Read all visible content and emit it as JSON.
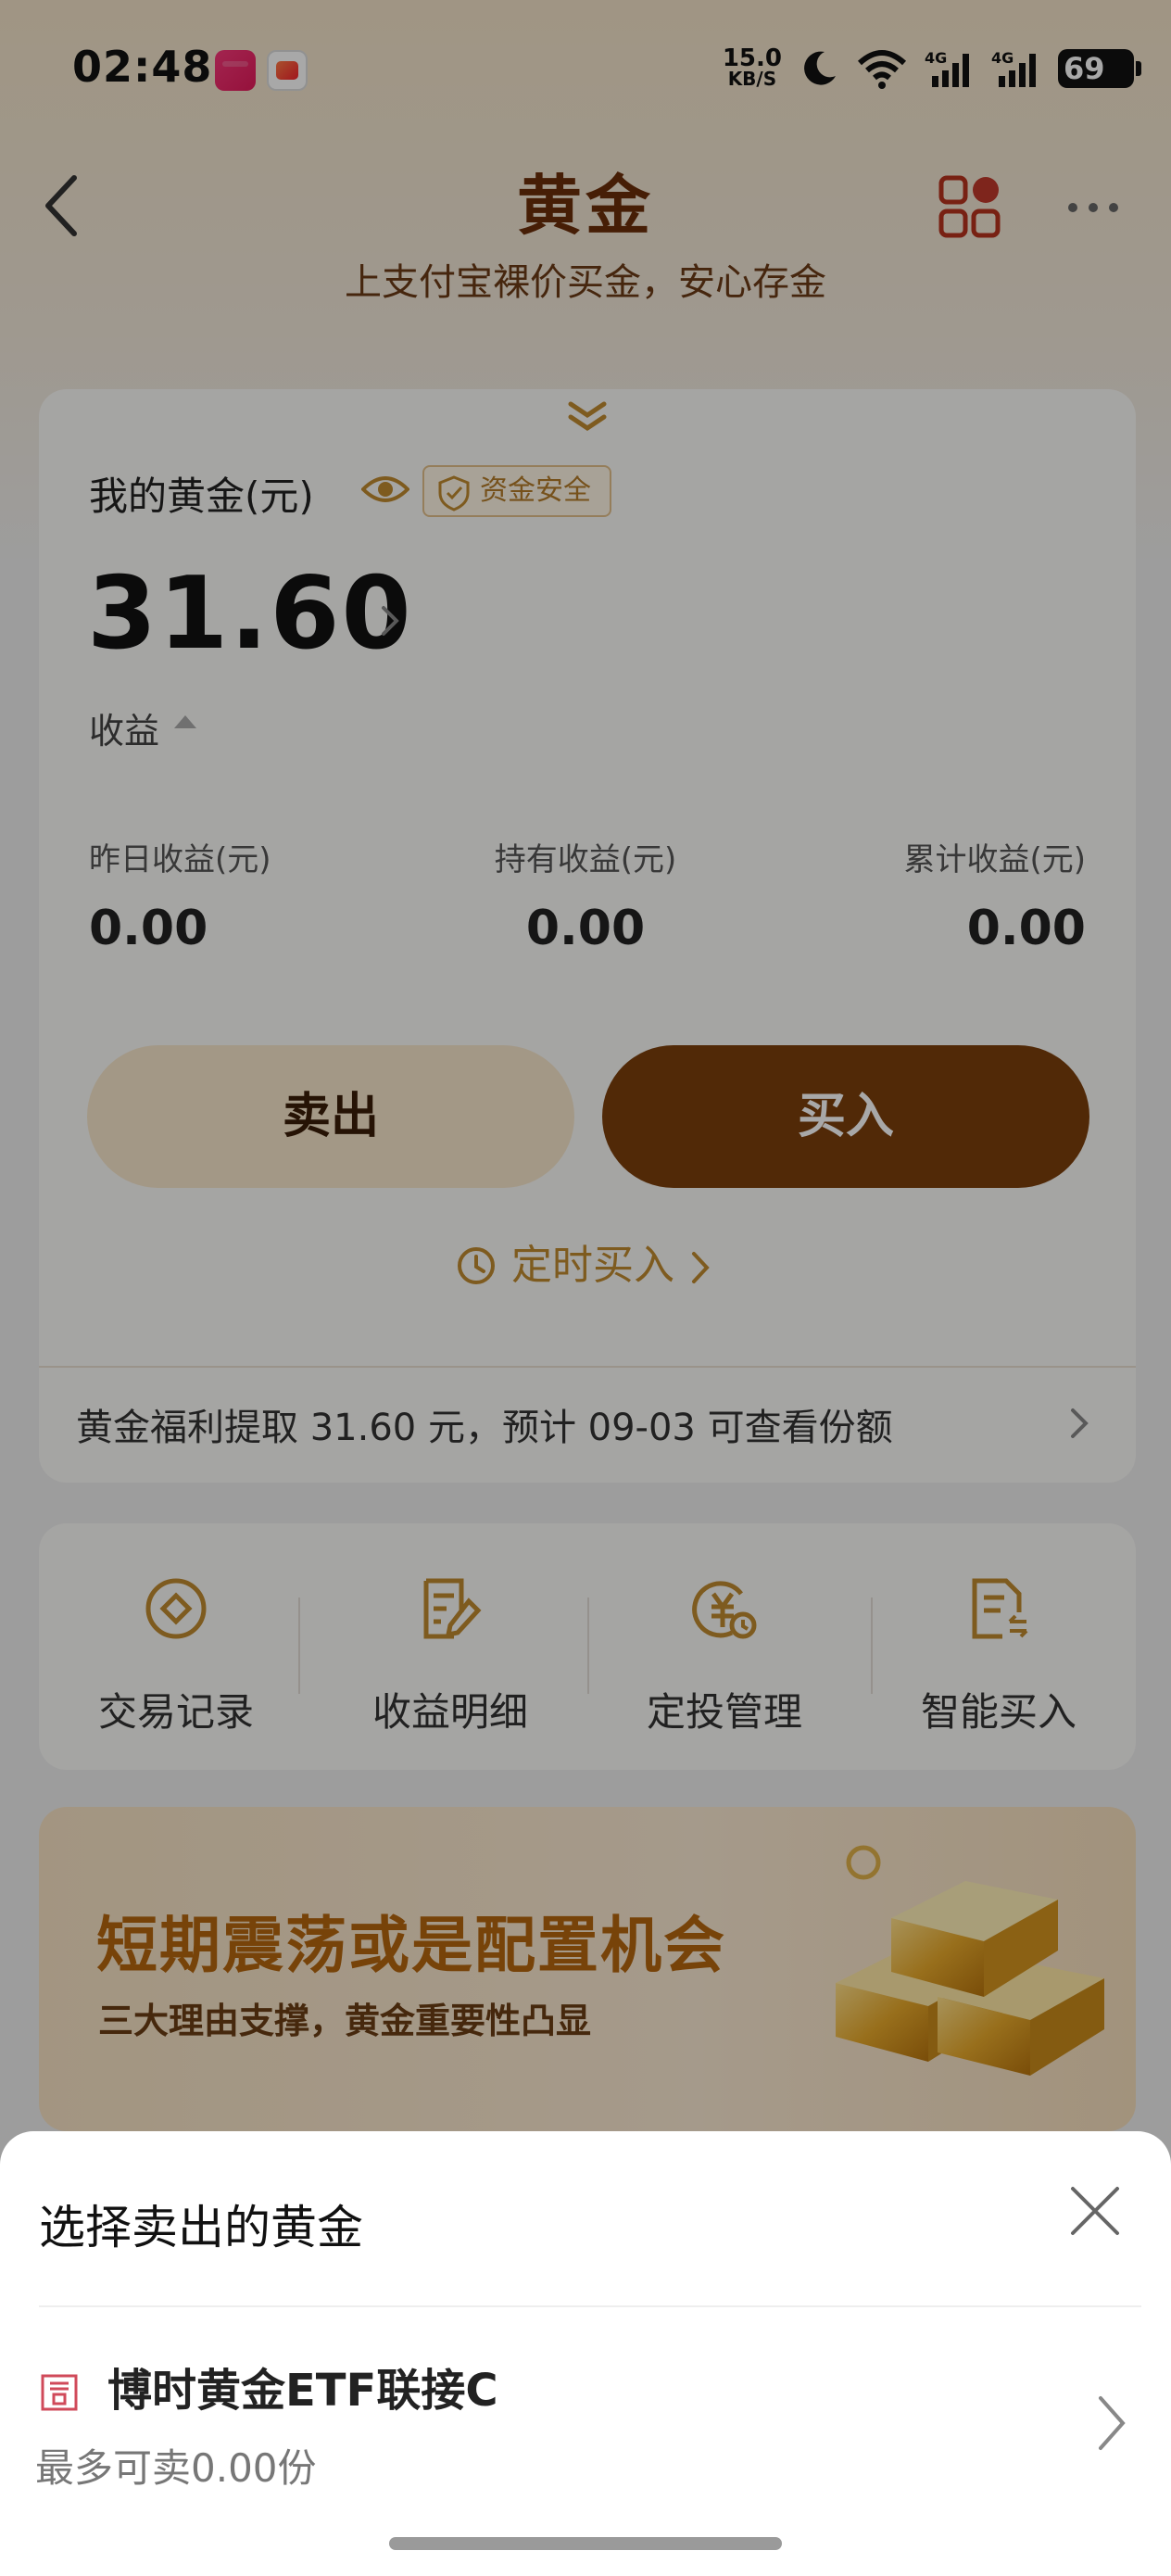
{
  "status_bar": {
    "time": "02:48",
    "net_speed_value": "15.0",
    "net_speed_unit": "KB/S",
    "signal1": "4G",
    "signal2": "4G",
    "battery": "69"
  },
  "header": {
    "title": "黄金",
    "subtitle": "上支付宝裸价买金，安心存金"
  },
  "main_card": {
    "my_gold_label": "我的黄金(元)",
    "safe_badge": "资金安全",
    "balance": "31.60",
    "earnings_label": "收益",
    "stats": [
      {
        "label": "昨日收益(元)",
        "value": "0.00"
      },
      {
        "label": "持有收益(元)",
        "value": "0.00"
      },
      {
        "label": "累计收益(元)",
        "value": "0.00"
      }
    ],
    "sell_label": "卖出",
    "buy_label": "买入",
    "timed_buy_label": "定时买入",
    "welfare_text": "黄金福利提取 31.60 元，预计 09-03 可查看份额"
  },
  "shortcuts": [
    {
      "label": "交易记录",
      "icon": "trade-record-icon"
    },
    {
      "label": "收益明细",
      "icon": "earnings-detail-icon"
    },
    {
      "label": "定投管理",
      "icon": "auto-invest-icon"
    },
    {
      "label": "智能买入",
      "icon": "smart-buy-icon"
    }
  ],
  "banner": {
    "title": "短期震荡或是配置机会",
    "subtitle": "三大理由支撑，黄金重要性凸显"
  },
  "sheet": {
    "title": "选择卖出的黄金",
    "fund_name": "博时黄金ETF联接C",
    "fund_available": "最多可卖0.00份"
  },
  "colors": {
    "brand_brown": "#7c3f0c",
    "gold_accent": "#c08a30",
    "sell_bg": "#f7e7cc"
  }
}
